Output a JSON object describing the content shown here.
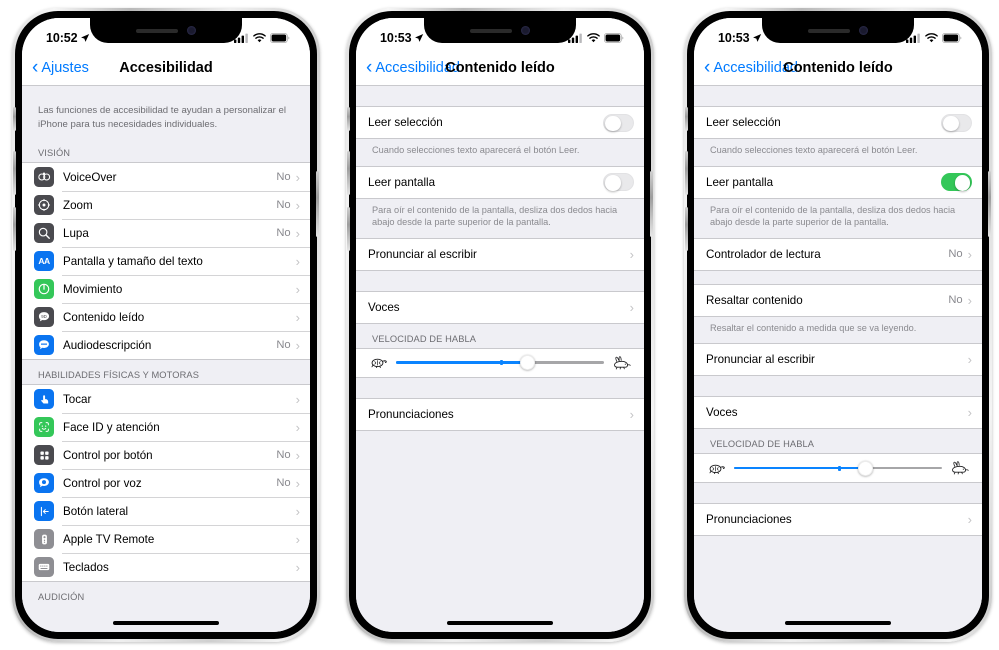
{
  "phones": [
    {
      "name": "accessibility-screen",
      "status": {
        "time": "10:52",
        "location_icon": "location-arrow-icon",
        "signal": "signal-bars-icon",
        "wifi": "wifi-icon",
        "battery": "battery-icon"
      },
      "nav": {
        "back_label": "Ajustes",
        "title": "Accesibilidad"
      },
      "blurb": "Las funciones de accesibilidad te ayudan a personalizar el iPhone para tus necesidades individuales.",
      "sections": [
        {
          "header": "VISIÓN",
          "rows": [
            {
              "label": "VoiceOver",
              "value": "No",
              "icon": "voiceover-icon",
              "color": "#4a4a4f",
              "glyph": "◉"
            },
            {
              "label": "Zoom",
              "value": "No",
              "icon": "zoom-icon",
              "color": "#4a4a4f",
              "glyph": "◎"
            },
            {
              "label": "Lupa",
              "value": "No",
              "icon": "magnifier-icon",
              "color": "#4a4a4f",
              "glyph": "⌕"
            },
            {
              "label": "Pantalla y tamaño del texto",
              "value": "",
              "icon": "display-text-size-icon",
              "color": "#0a74f0",
              "glyph": "AA"
            },
            {
              "label": "Movimiento",
              "value": "",
              "icon": "motion-icon",
              "color": "#34c759",
              "glyph": "◍"
            },
            {
              "label": "Contenido leído",
              "value": "",
              "icon": "spoken-content-icon",
              "color": "#4a4a4f",
              "glyph": "◗"
            },
            {
              "label": "Audiodescripción",
              "value": "No",
              "icon": "audio-description-icon",
              "color": "#0a74f0",
              "glyph": "◖"
            }
          ]
        },
        {
          "header": "HABILIDADES FÍSICAS Y MOTORAS",
          "rows": [
            {
              "label": "Tocar",
              "value": "",
              "icon": "touch-icon",
              "color": "#0a74f0",
              "glyph": "☟"
            },
            {
              "label": "Face ID y atención",
              "value": "",
              "icon": "face-id-icon",
              "color": "#34c759",
              "glyph": "☺"
            },
            {
              "label": "Control por botón",
              "value": "No",
              "icon": "switch-control-icon",
              "color": "#4a4a4f",
              "glyph": "▦"
            },
            {
              "label": "Control por voz",
              "value": "No",
              "icon": "voice-control-icon",
              "color": "#0a74f0",
              "glyph": "◔"
            },
            {
              "label": "Botón lateral",
              "value": "",
              "icon": "side-button-icon",
              "color": "#0a74f0",
              "glyph": "⟵"
            },
            {
              "label": "Apple TV Remote",
              "value": "",
              "icon": "apple-tv-remote-icon",
              "color": "#8e8e93",
              "glyph": "▯"
            },
            {
              "label": "Teclados",
              "value": "",
              "icon": "keyboards-icon",
              "color": "#8e8e93",
              "glyph": "▭"
            }
          ]
        },
        {
          "header": "AUDICIÓN",
          "rows": []
        }
      ]
    },
    {
      "name": "spoken-content-screen-off",
      "status": {
        "time": "10:53",
        "location_icon": "location-arrow-icon",
        "signal": "signal-bars-icon",
        "wifi": "wifi-icon",
        "battery": "battery-icon"
      },
      "nav": {
        "back_label": "Accesibilidad",
        "title": "Contenido leído"
      },
      "rows": {
        "speak_selection_label": "Leer selección",
        "speak_selection_on": false,
        "speak_selection_footer": "Cuando selecciones texto aparecerá el botón Leer.",
        "speak_screen_label": "Leer pantalla",
        "speak_screen_on": false,
        "speak_screen_footer": "Para oír el contenido de la pantalla, desliza dos dedos hacia abajo desde la parte superior de la pantalla.",
        "typing_feedback_label": "Pronunciar al escribir",
        "voices_label": "Voces",
        "speaking_rate_header": "VELOCIDAD DE HABLA",
        "speaking_rate_percent": 63,
        "slider_tick_percent": 50,
        "slider_left_icon": "turtle-icon",
        "slider_right_icon": "rabbit-icon",
        "pronunciations_label": "Pronunciaciones"
      }
    },
    {
      "name": "spoken-content-screen-on",
      "status": {
        "time": "10:53",
        "location_icon": "location-arrow-icon",
        "signal": "signal-bars-icon",
        "wifi": "wifi-icon",
        "battery": "battery-icon"
      },
      "nav": {
        "back_label": "Accesibilidad",
        "title": "Contenido leído"
      },
      "rows": {
        "speak_selection_label": "Leer selección",
        "speak_selection_on": false,
        "speak_selection_footer": "Cuando selecciones texto aparecerá el botón Leer.",
        "speak_screen_label": "Leer pantalla",
        "speak_screen_on": true,
        "speak_screen_footer": "Para oír el contenido de la pantalla, desliza dos dedos hacia abajo desde la parte superior de la pantalla.",
        "speech_controller_label": "Controlador de lectura",
        "speech_controller_value": "No",
        "highlight_content_label": "Resaltar contenido",
        "highlight_content_value": "No",
        "highlight_content_footer": "Resaltar el contenido a medida que se va leyendo.",
        "typing_feedback_label": "Pronunciar al escribir",
        "voices_label": "Voces",
        "speaking_rate_header": "VELOCIDAD DE HABLA",
        "speaking_rate_percent": 63,
        "slider_tick_percent": 50,
        "slider_left_icon": "turtle-icon",
        "slider_right_icon": "rabbit-icon",
        "pronunciations_label": "Pronunciaciones"
      }
    }
  ],
  "colors": {
    "accent_blue": "#007aff",
    "toggle_green": "#34c759",
    "slider_blue": "#0a84ff",
    "bg_gray": "#efeff4"
  }
}
